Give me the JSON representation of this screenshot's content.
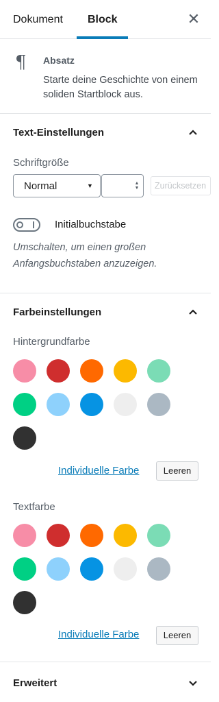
{
  "tabs": {
    "document": "Dokument",
    "block": "Block",
    "close_icon": "close-icon"
  },
  "block": {
    "icon": "paragraph-icon",
    "title": "Absatz",
    "description": "Starte deine Geschichte von einem soliden Startblock aus."
  },
  "text_settings": {
    "heading": "Text-Einstellungen",
    "font_size_label": "Schriftgröße",
    "font_size_value": "Normal",
    "custom_size_value": "",
    "reset_label": "Zurücksetzen",
    "drop_cap_label": "Initialbuchstabe",
    "drop_cap_enabled": false,
    "drop_cap_help": "Umschalten, um einen großen Anfangsbuchstaben anzuzeigen."
  },
  "color_settings": {
    "heading": "Farbeinstellungen",
    "background": {
      "label": "Hintergrundfarbe",
      "custom_link": "Individuelle Farbe",
      "clear_button": "Leeren"
    },
    "text": {
      "label": "Textfarbe",
      "custom_link": "Individuelle Farbe",
      "clear_button": "Leeren"
    },
    "palette": [
      "#f78da7",
      "#cf2e2e",
      "#ff6900",
      "#fcb900",
      "#7bdcb5",
      "#00d084",
      "#8ed1fc",
      "#0693e3",
      "#eeeeee",
      "#abb8c3",
      "#313131"
    ]
  },
  "advanced": {
    "heading": "Erweitert"
  },
  "colors": {
    "accent": "#0a7cb8"
  }
}
